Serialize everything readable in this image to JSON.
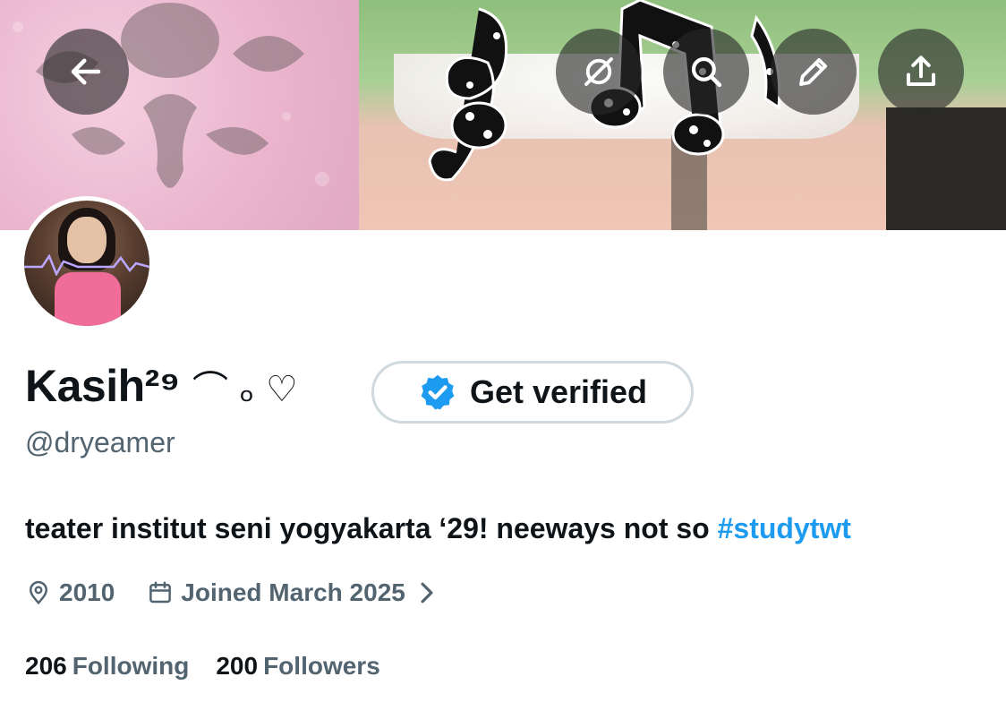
{
  "profile": {
    "display_name": "Kasih²⁹",
    "name_decoration": "⌒ ₒ ♡",
    "handle": "@dryeamer",
    "bio_text": "teater institut seni yogyakarta ‘29! neeways not so ",
    "bio_hashtag": "#studytwt",
    "location": "2010",
    "joined": "Joined March 2025"
  },
  "actions": {
    "get_verified_label": "Get verified"
  },
  "stats": {
    "following_count": "206",
    "following_label": "Following",
    "followers_count": "200",
    "followers_label": "Followers"
  },
  "icons": {
    "back": "arrow-left-icon",
    "grok": "grok-icon",
    "search": "search-icon",
    "edit": "pencil-icon",
    "share": "share-icon",
    "verified": "verified-badge-icon",
    "location": "location-pin-icon",
    "calendar": "calendar-icon"
  },
  "colors": {
    "accent": "#1d9bf0",
    "secondary_text": "#536471",
    "primary_text": "#0f1419",
    "button_border": "#cfd9de"
  }
}
